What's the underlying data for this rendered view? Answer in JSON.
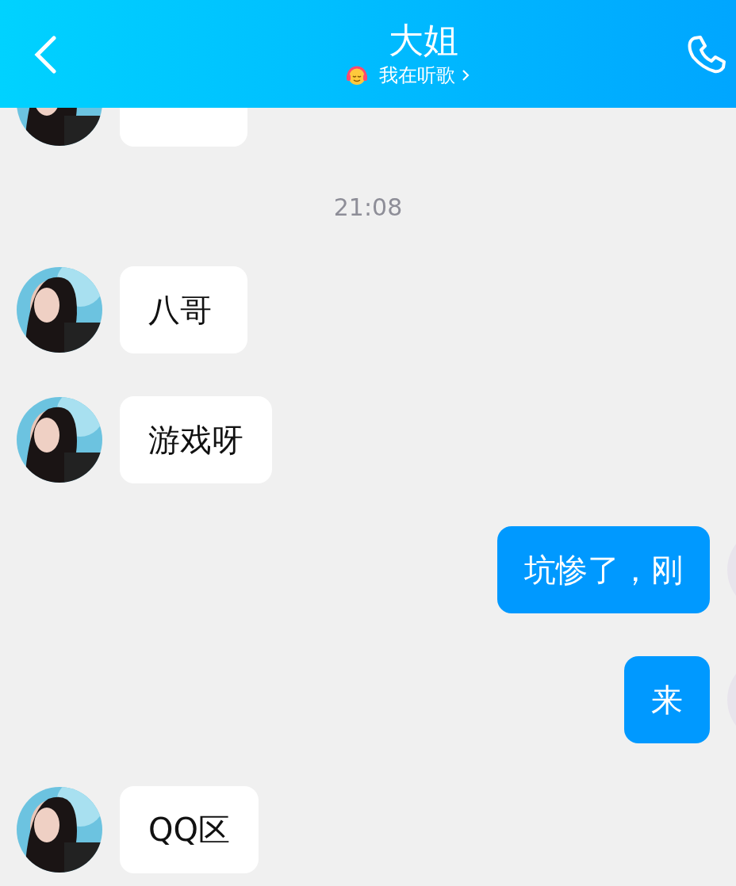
{
  "header": {
    "title": "大姐",
    "status": "我在听歌"
  },
  "messages": [
    {
      "kind": "received"
    },
    {
      "kind": "time",
      "text": "21:08"
    },
    {
      "kind": "received",
      "text": "八哥"
    },
    {
      "kind": "received",
      "text": "游戏呀"
    },
    {
      "kind": "sent",
      "text": "坑惨了，刚"
    },
    {
      "kind": "sent",
      "text": "来"
    },
    {
      "kind": "received",
      "text": "QQ区"
    }
  ]
}
